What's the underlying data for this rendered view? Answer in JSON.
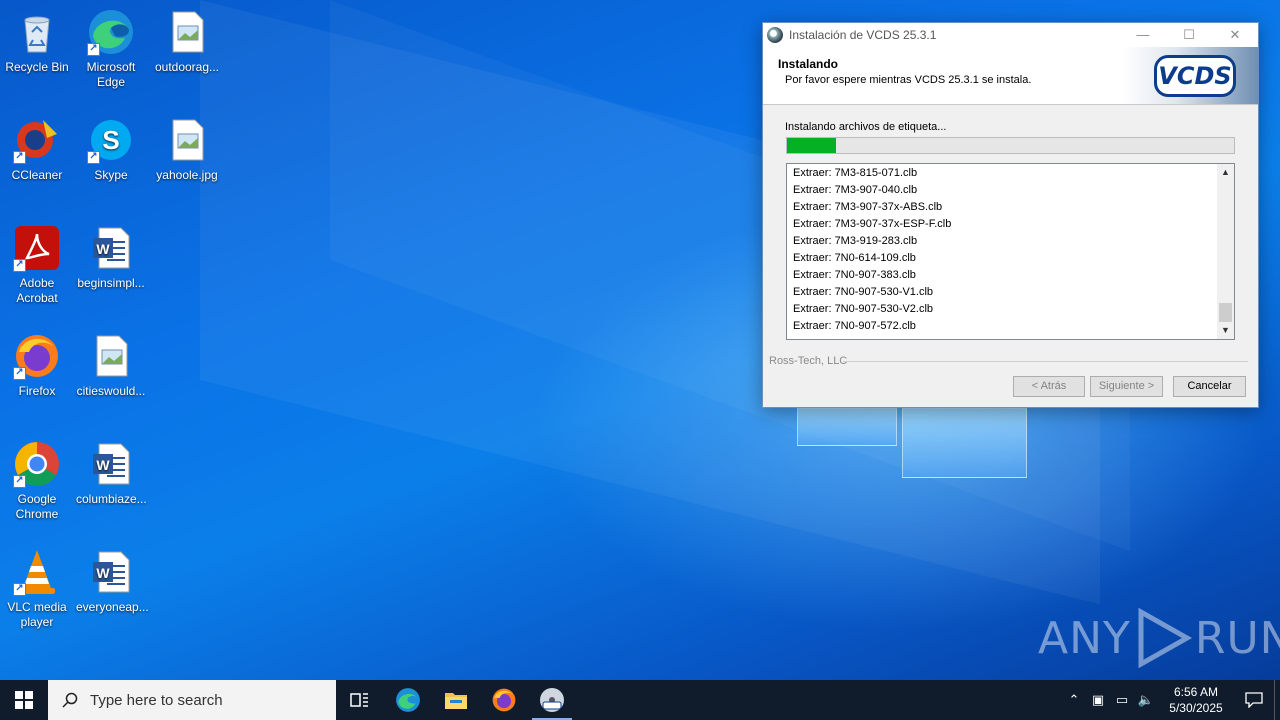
{
  "desktop": {
    "icons": [
      {
        "label": "Recycle Bin"
      },
      {
        "label": "Microsoft Edge"
      },
      {
        "label": "outdoorag..."
      },
      {
        "label": "CCleaner"
      },
      {
        "label": "Skype"
      },
      {
        "label": "yahoole.jpg"
      },
      {
        "label": "Adobe Acrobat"
      },
      {
        "label": "beginsimpl..."
      },
      {
        "label": "Firefox"
      },
      {
        "label": "citieswould..."
      },
      {
        "label": "Google Chrome"
      },
      {
        "label": "columbiaze..."
      },
      {
        "label": "VLC media player"
      },
      {
        "label": "everyoneap..."
      }
    ],
    "watermark": {
      "left": "ANY",
      "right": "RUN"
    }
  },
  "installer": {
    "title": "Instalación de VCDS 25.3.1",
    "controls": {
      "minimize": "—",
      "maximize": "☐",
      "close": "✕"
    },
    "header_title": "Instalando",
    "header_subtitle": "Por favor espere mientras VCDS 25.3.1 se instala.",
    "logo_text": "VCDS",
    "status": "Instalando archivos de etiqueta...",
    "progress_fraction": 0.11,
    "log_lines": [
      "Extraer: 7M3-815-071.clb",
      "Extraer: 7M3-907-040.clb",
      "Extraer: 7M3-907-37x-ABS.clb",
      "Extraer: 7M3-907-37x-ESP-F.clb",
      "Extraer: 7M3-919-283.clb",
      "Extraer: 7N0-614-109.clb",
      "Extraer: 7N0-907-383.clb",
      "Extraer: 7N0-907-530-V1.clb",
      "Extraer: 7N0-907-530-V2.clb",
      "Extraer: 7N0-907-572.clb"
    ],
    "brand": "Ross-Tech, LLC",
    "buttons": {
      "back": "< Atrás",
      "next": "Siguiente >",
      "cancel": "Cancelar"
    }
  },
  "taskbar": {
    "search_placeholder": "Type here to search",
    "time": "6:56 AM",
    "date": "5/30/2025"
  },
  "colors": {
    "progress": "#06b025",
    "taskbar": "#101c2c",
    "desktop": "#0a64d8"
  }
}
